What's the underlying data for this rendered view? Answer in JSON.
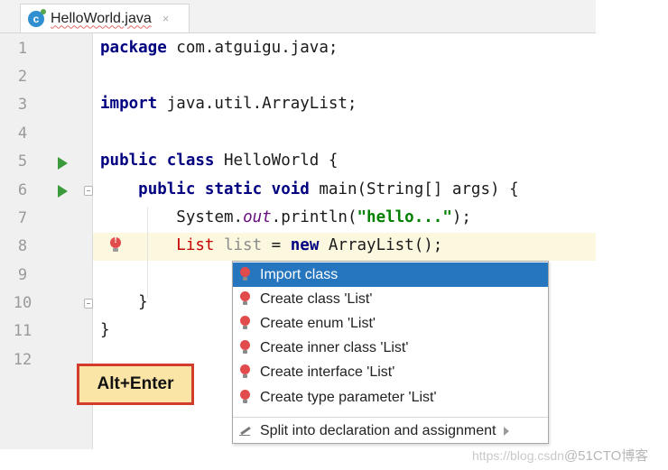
{
  "tab": {
    "title": "HelloWorld.java",
    "close_glyph": "×",
    "icon": "java-class-icon"
  },
  "line_numbers": [
    "1",
    "2",
    "3",
    "4",
    "5",
    "6",
    "7",
    "8",
    "9",
    "10",
    "11",
    "12"
  ],
  "code": {
    "l1": {
      "kw": "package",
      "rest": " com.atguigu.java;"
    },
    "l3": {
      "kw": "import",
      "rest": " java.util.ArrayList;"
    },
    "l5": {
      "kw": "public class",
      "rest": " HelloWorld {"
    },
    "l6": {
      "indent": "    ",
      "kw": "public static void",
      "rest": " main(String[] args) {"
    },
    "l7": {
      "indent": "        ",
      "a": "System.",
      "fld": "out",
      "b": ".println(",
      "str": "\"hello...\"",
      "c": ");"
    },
    "l8": {
      "indent": "        ",
      "err": "List",
      "unused": " list",
      "a": " = ",
      "kw": "new",
      "b": " ArrayList();"
    },
    "l10": {
      "indent": "    ",
      "text": "}"
    },
    "l11": {
      "text": "}"
    }
  },
  "popup": {
    "items": [
      {
        "label": "Import class"
      },
      {
        "label": "Create class 'List'"
      },
      {
        "label": "Create enum 'List'"
      },
      {
        "label": "Create inner class 'List'"
      },
      {
        "label": "Create interface 'List'"
      },
      {
        "label": "Create type parameter 'List'"
      }
    ],
    "footer": "Split into declaration and assignment"
  },
  "shortcut_label": "Alt+Enter",
  "watermark": {
    "url": "https://blog.csdn",
    "brand": "@51CTO博客"
  },
  "colors": {
    "keyword": "#000080",
    "string": "#008000",
    "field": "#660e7a",
    "error": "#c40000",
    "selection": "#2675bf",
    "caret_line": "#fcf8e0"
  }
}
